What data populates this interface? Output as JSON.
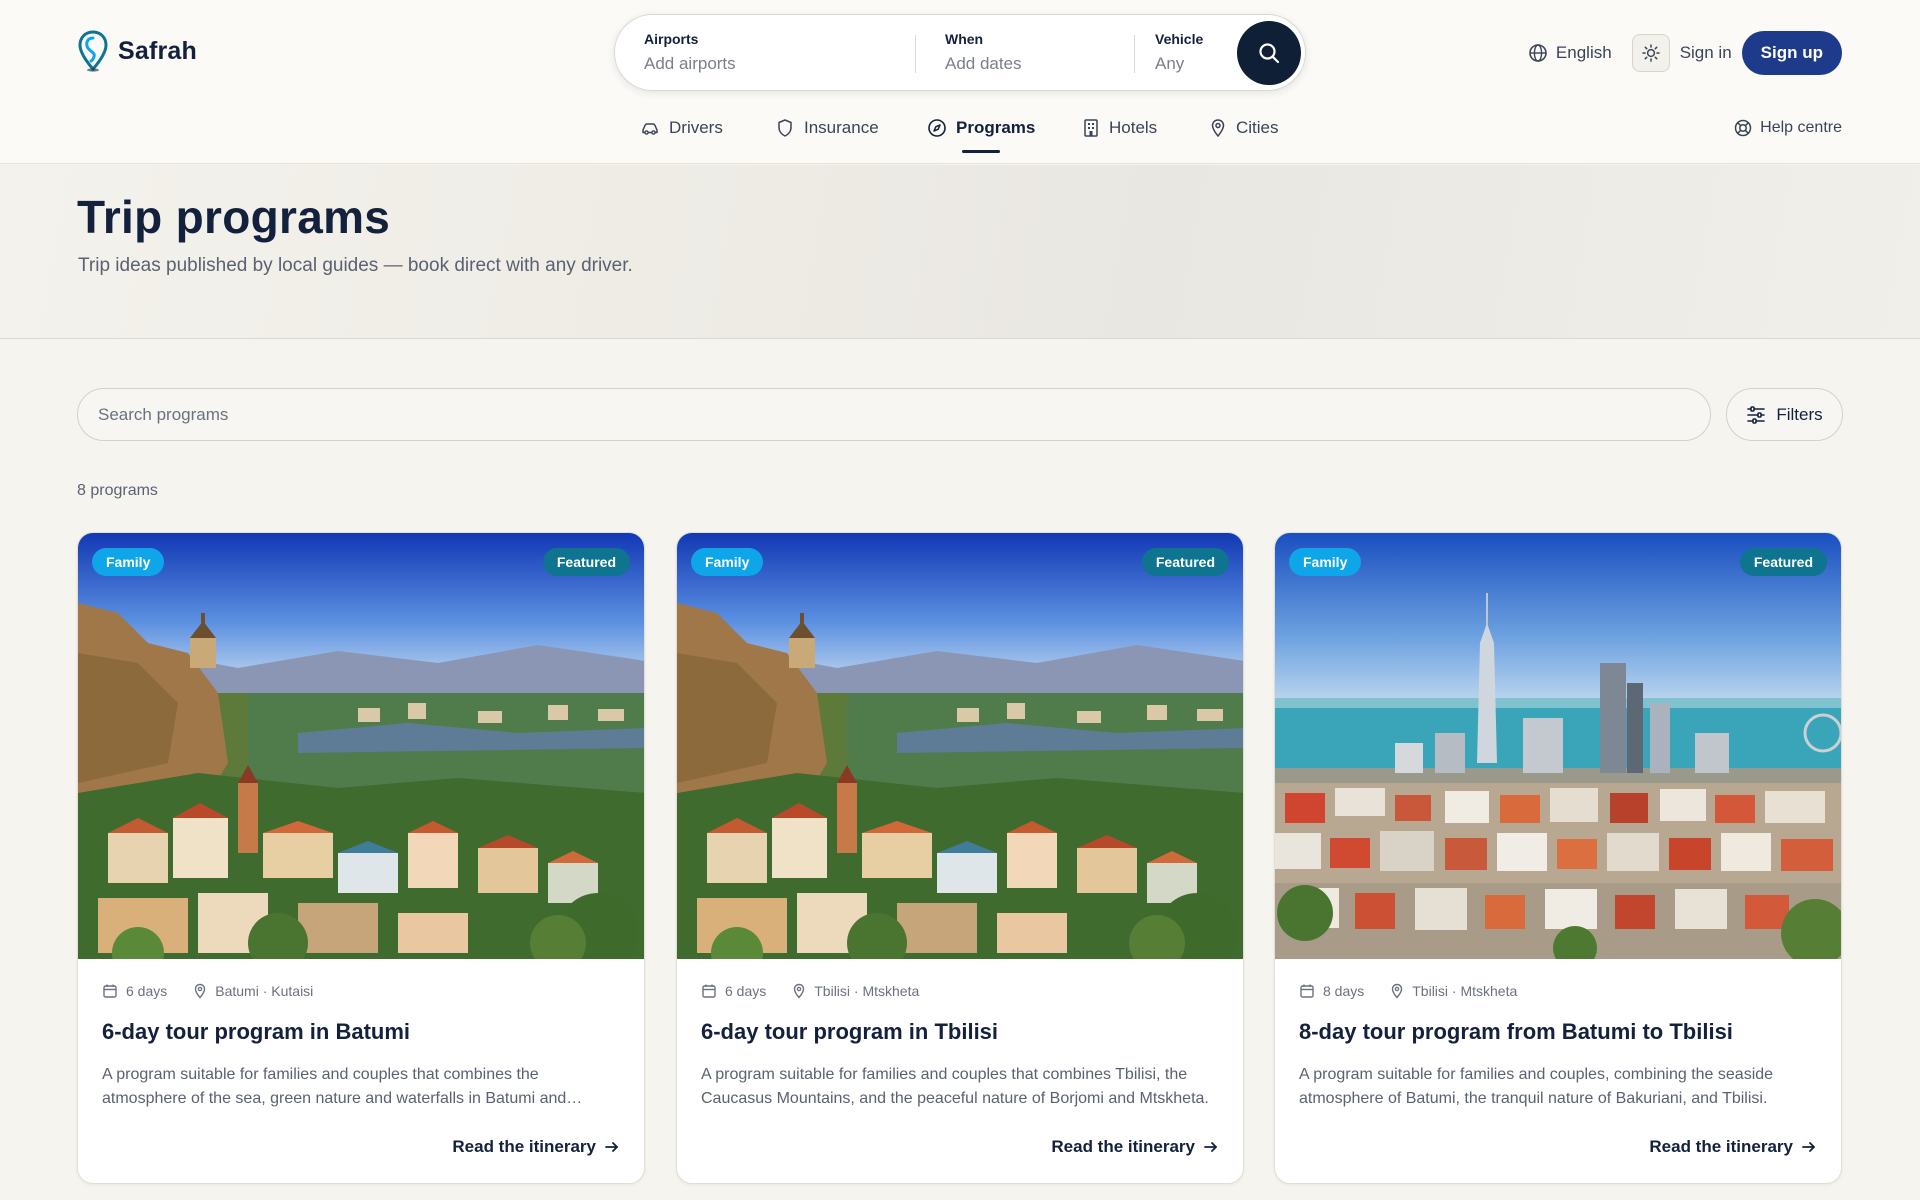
{
  "brand": {
    "name": "Safrah"
  },
  "search": {
    "airports_label": "Airports",
    "airports_value": "Add airports",
    "when_label": "When",
    "when_value": "Add dates",
    "vehicle_label": "Vehicle",
    "vehicle_value": "Any"
  },
  "header": {
    "language": "English",
    "sign_in": "Sign in",
    "sign_up": "Sign up"
  },
  "nav": {
    "items": [
      {
        "label": "Drivers",
        "icon": "car-icon"
      },
      {
        "label": "Insurance",
        "icon": "shield-icon"
      },
      {
        "label": "Programs",
        "icon": "compass-icon",
        "active": true
      },
      {
        "label": "Hotels",
        "icon": "building-icon"
      },
      {
        "label": "Cities",
        "icon": "map-pin-icon"
      }
    ],
    "help": "Help centre"
  },
  "hero": {
    "title": "Trip programs",
    "subtitle": "Trip ideas published by local guides — book direct with any driver."
  },
  "programs_search": {
    "placeholder": "Search programs"
  },
  "filters": {
    "label": "Filters"
  },
  "results": {
    "count": "8 programs"
  },
  "cards": [
    {
      "badge_left": "Family",
      "badge_right": "Featured",
      "days": "6 days",
      "route": "Batumi · Kutaisi",
      "title": "6-day tour program in Batumi",
      "description": "A program suitable for families and couples that combines the atmosphere of the sea, green nature and waterfalls in Batumi and Kutaisi.",
      "link": "Read the itinerary",
      "image": "tbilisi-old-town"
    },
    {
      "badge_left": "Family",
      "badge_right": "Featured",
      "days": "6 days",
      "route": "Tbilisi · Mtskheta",
      "title": "6-day tour program in Tbilisi",
      "description": "A program suitable for families and couples that combines Tbilisi, the Caucasus Mountains, and the peaceful nature of Borjomi and Mtskheta.",
      "link": "Read the itinerary",
      "image": "tbilisi-old-town"
    },
    {
      "badge_left": "Family",
      "badge_right": "Featured",
      "days": "8 days",
      "route": "Tbilisi · Mtskheta",
      "title": "8-day tour program from Batumi to Tbilisi",
      "description": "A program suitable for families and couples, combining the seaside atmosphere of Batumi, the tranquil nature of Bakuriani, and Tbilisi.",
      "link": "Read the itinerary",
      "image": "batumi-skyline"
    }
  ],
  "colors": {
    "primary": "#1e3a8a",
    "ink": "#14213d",
    "badge_family": "#0ea5e9",
    "badge_featured": "#0e7490",
    "background": "#f6f4ef"
  }
}
